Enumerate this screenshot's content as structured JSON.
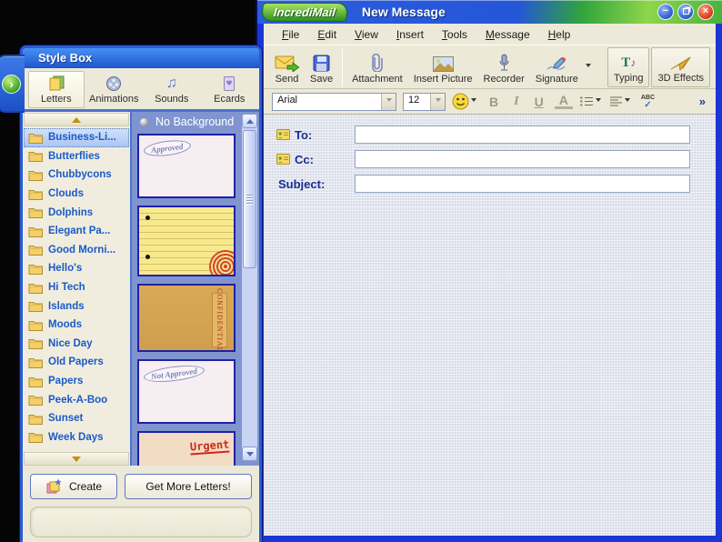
{
  "compose_window": {
    "logo_text": "IncrediMail",
    "title": "New Message",
    "window_buttons": {
      "minimize": "−",
      "close": "×"
    },
    "menu_items": [
      "File",
      "Edit",
      "View",
      "Insert",
      "Tools",
      "Message",
      "Help"
    ],
    "toolbar": {
      "send": "Send",
      "save": "Save",
      "attachment": "Attachment",
      "insert_picture": "Insert Picture",
      "recorder": "Recorder",
      "signature": "Signature",
      "typing": "Typing",
      "effects": "3D Effects",
      "typing_glyph": "T",
      "typing_note": "♪"
    },
    "format_bar": {
      "font_name": "Arial",
      "font_size": "12",
      "bold": "B",
      "italic": "I",
      "underline": "U",
      "font_color": "A",
      "spell_text": "ABC",
      "spell_check": "✓",
      "more": "»"
    },
    "fields": {
      "to_label": "To:",
      "cc_label": "Cc:",
      "subject_label": "Subject:",
      "to_value": "",
      "cc_value": "",
      "subject_value": ""
    }
  },
  "stylebox": {
    "title": "Style Box",
    "side_arrow": "›",
    "tabs": [
      {
        "label": "Letters",
        "selected": true
      },
      {
        "label": "Animations",
        "selected": false
      },
      {
        "label": "Sounds",
        "selected": false
      },
      {
        "label": "Ecards",
        "selected": false
      }
    ],
    "sounds_icon_glyph": "♫",
    "categories": [
      "Business-Li...",
      "Butterflies",
      "Chubbycons",
      "Clouds",
      "Dolphins",
      "Elegant Pa...",
      "Good Morni...",
      "Hello's",
      "Hi Tech",
      "Islands",
      "Moods",
      "Nice Day",
      "Old Papers",
      "Papers",
      "Peek-A-Boo",
      "Sunset",
      "Week Days"
    ],
    "selected_category": "Business-Li...",
    "no_background_label": "No Background",
    "thumbnails": [
      {
        "name": "approved-letter",
        "stamp": "Approved",
        "selected": true
      },
      {
        "name": "yellow-notepad",
        "stamp": ""
      },
      {
        "name": "confidential-envelope",
        "stamp": "CONFIDENTIAL"
      },
      {
        "name": "not-approved-letter",
        "stamp": "Not Approved"
      },
      {
        "name": "urgent-letter",
        "stamp": "Urgent"
      }
    ],
    "create_button": "Create",
    "get_more_button": "Get More Letters!"
  },
  "colors": {
    "xp_cream": "#ece9d8",
    "title_blue": "#2456d8",
    "title_green": "#46b23a",
    "panel_periwinkle": "#8095cf",
    "category_text": "#1a5ac8",
    "window_border_blue": "#1c36d6",
    "label_navy": "#1b2d8f"
  }
}
